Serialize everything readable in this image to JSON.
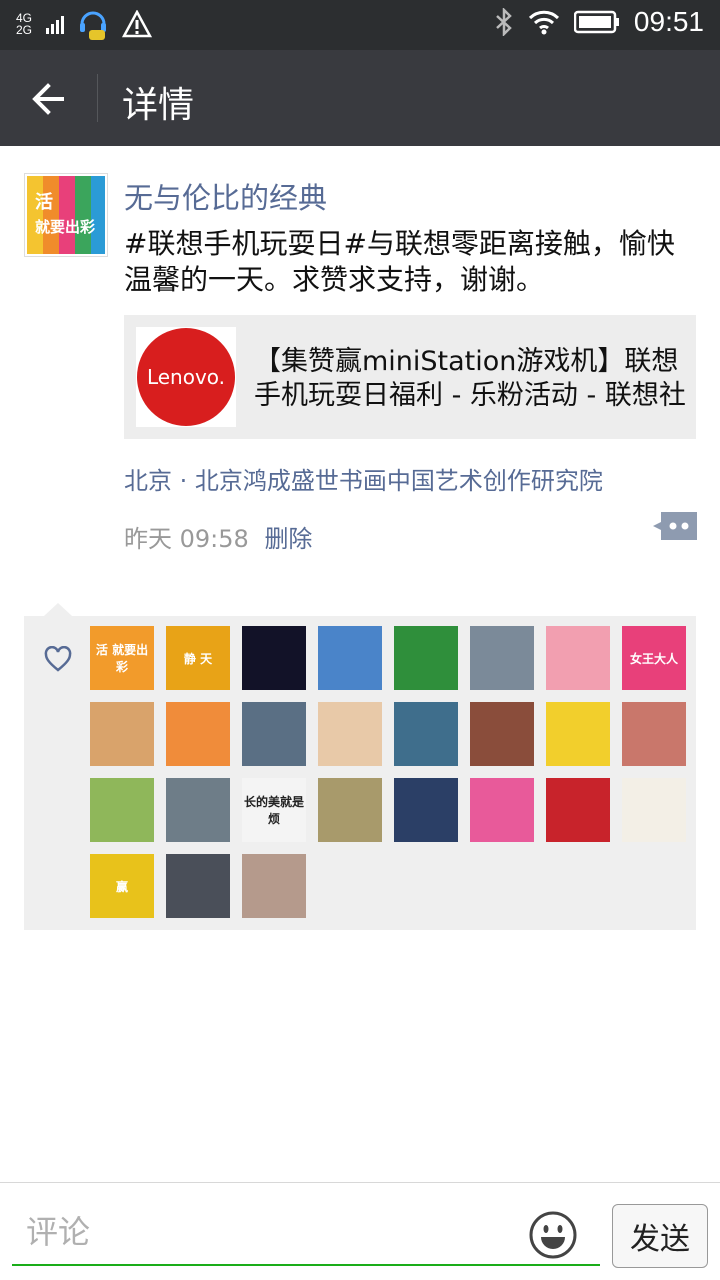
{
  "status_bar": {
    "network_top": "4G",
    "network_bottom": "2G",
    "time": "09:51",
    "icons": [
      "signal-icon",
      "support-icon",
      "warning-icon",
      "bluetooth-icon",
      "wifi-icon",
      "battery-icon"
    ]
  },
  "header": {
    "title": "详情",
    "back_icon": "arrow-left-icon"
  },
  "post": {
    "author": "无与伦比的经典",
    "avatar_text": "活\n就要出彩",
    "content": "#联想手机玩耍日#与联想零距离接触，愉快温馨的一天。求赞求支持，谢谢。",
    "link": {
      "title": "【集赞赢miniStation游戏机】联想手机玩耍日福利 - 乐粉活动 - 联想社",
      "thumb_text": "Lenovo."
    },
    "location": "北京 · 北京鸿成盛世书画中国艺术创作研究院",
    "time": "昨天 09:58",
    "delete_label": "删除"
  },
  "likes": {
    "icon": "heart-icon",
    "avatars": [
      {
        "text": "活\n就要出彩",
        "bg": "#f29b2b"
      },
      {
        "text": "静\n天",
        "bg": "#e8a317"
      },
      {
        "text": "",
        "bg": "#121228"
      },
      {
        "text": "",
        "bg": "#4a84c9"
      },
      {
        "text": "",
        "bg": "#2f8f3b"
      },
      {
        "text": "",
        "bg": "#7b8a99"
      },
      {
        "text": "",
        "bg": "#f29fb0"
      },
      {
        "text": "女王大人",
        "bg": "#e8407a"
      },
      {
        "text": "",
        "bg": "#d9a36b"
      },
      {
        "text": "",
        "bg": "#f08c3a"
      },
      {
        "text": "",
        "bg": "#5a6f84"
      },
      {
        "text": "",
        "bg": "#e8c9a8"
      },
      {
        "text": "",
        "bg": "#3f6e8c"
      },
      {
        "text": "",
        "bg": "#8a4d3b"
      },
      {
        "text": "",
        "bg": "#f2cf2c"
      },
      {
        "text": "",
        "bg": "#c9776b"
      },
      {
        "text": "",
        "bg": "#8fb75a"
      },
      {
        "text": "",
        "bg": "#6e7d88"
      },
      {
        "text": "长的美就是烦",
        "bg": "#f4f4f4"
      },
      {
        "text": "",
        "bg": "#a89a6b"
      },
      {
        "text": "",
        "bg": "#2b3f66"
      },
      {
        "text": "",
        "bg": "#e85a9a"
      },
      {
        "text": "",
        "bg": "#c8232b"
      },
      {
        "text": "",
        "bg": "#f3efe6"
      },
      {
        "text": "赢",
        "bg": "#e8c21b"
      },
      {
        "text": "",
        "bg": "#4a4f59"
      },
      {
        "text": "",
        "bg": "#b59a8c"
      }
    ]
  },
  "comment": {
    "placeholder": "评论",
    "send_label": "发送",
    "emoji_icon": "smiley-icon"
  },
  "colors": {
    "accent_link": "#576b95",
    "input_underline": "#1aad19",
    "titlebar": "#393a3f",
    "statusbar": "#2c2e30"
  }
}
